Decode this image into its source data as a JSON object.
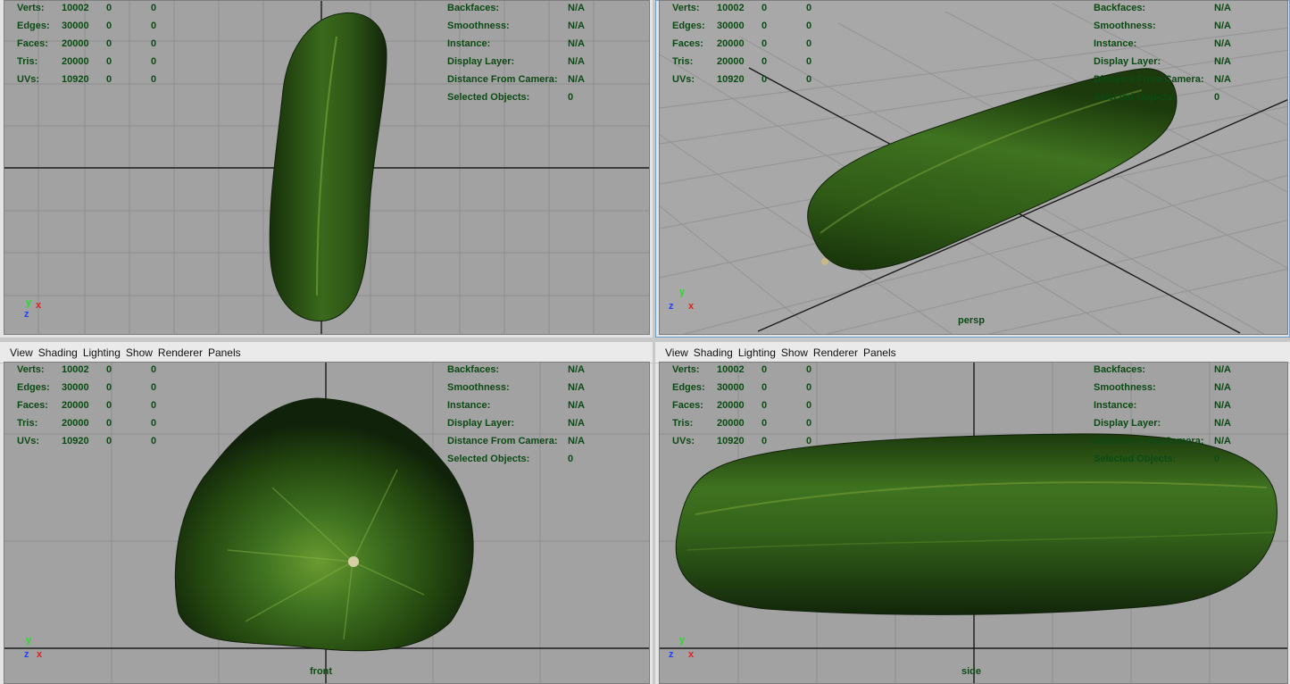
{
  "colors": {
    "viewport_bg": "#a2a2a2",
    "grid": "#8e8e8e",
    "hud_text": "#0c4a14",
    "cucumber_dark": "#16300a",
    "cucumber_mid": "#2f5a16",
    "cucumber_light": "#5e8a2a"
  },
  "menu": [
    "View",
    "Shading",
    "Lighting",
    "Show",
    "Renderer",
    "Panels"
  ],
  "stats": {
    "labels": [
      "Verts:",
      "Edges:",
      "Faces:",
      "Tris:",
      "UVs:"
    ],
    "values": [
      "10002",
      "30000",
      "20000",
      "20000",
      "10920"
    ],
    "sel": [
      "0",
      "0",
      "0",
      "0",
      "0"
    ],
    "sel2": [
      "0",
      "0",
      "0",
      "0",
      "0"
    ]
  },
  "info": {
    "labels": [
      "Backfaces:",
      "Smoothness:",
      "Instance:",
      "Display Layer:",
      "Distance From Camera:",
      "Selected Objects:"
    ],
    "values": [
      "N/A",
      "N/A",
      "N/A",
      "N/A",
      "N/A",
      "0"
    ]
  },
  "panels": {
    "top": {
      "camera": ""
    },
    "persp": {
      "camera": "persp"
    },
    "front": {
      "camera": "front"
    },
    "side": {
      "camera": "side"
    }
  },
  "axis_labels": {
    "x": "x",
    "y": "y",
    "z": "z"
  }
}
